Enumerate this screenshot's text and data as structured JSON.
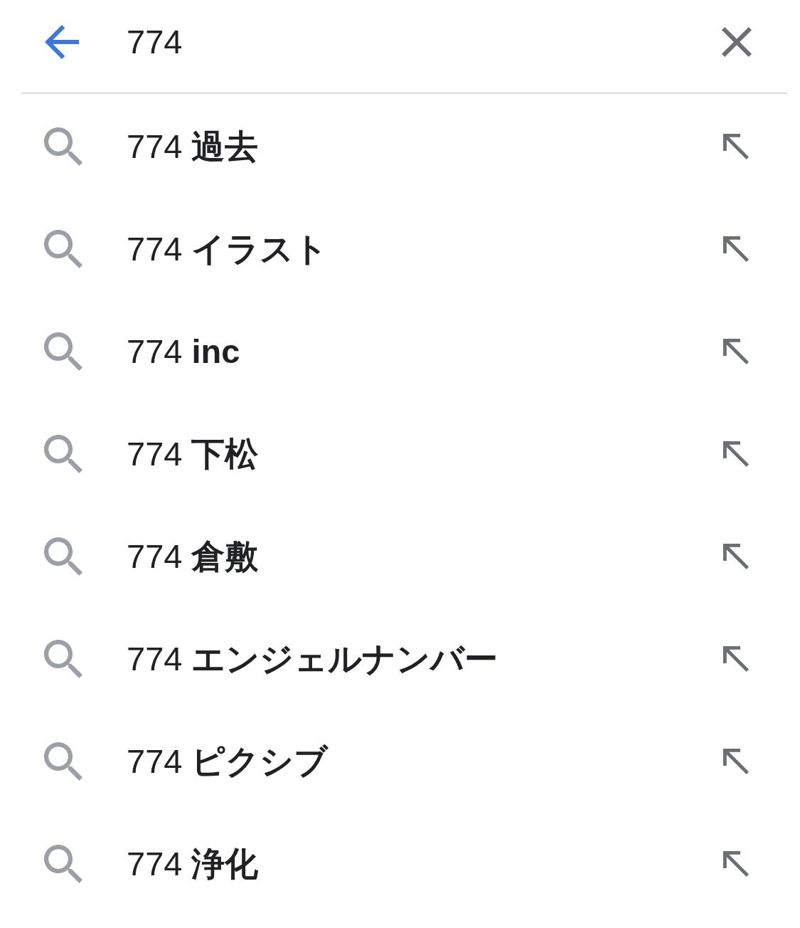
{
  "search_bar": {
    "value": "774"
  },
  "suggestions": [
    {
      "text": "774 **過去**"
    },
    {
      "text": "774 **イラスト**"
    },
    {
      "text": "774 **inc**"
    },
    {
      "text": "774 **下松**"
    },
    {
      "text": "774 **倉敷**"
    },
    {
      "text": "774 **エンジェルナンバー**"
    },
    {
      "text": "774 **ピクシブ**"
    },
    {
      "text": "774 **浄化**"
    }
  ]
}
